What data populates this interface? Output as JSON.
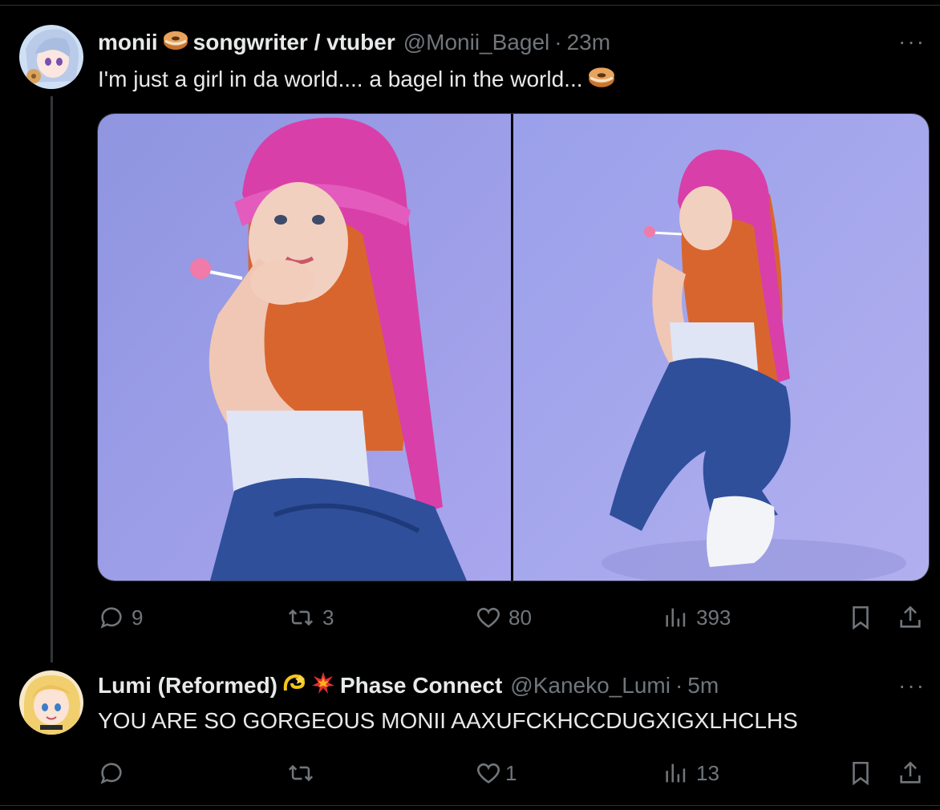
{
  "tweets": [
    {
      "display_name": "monii",
      "bio_tag": "songwriter / vtuber",
      "handle": "@Monii_Bagel",
      "time": "23m",
      "text": "I'm just a girl in da world.... a bagel in the world...",
      "stats": {
        "replies": "9",
        "retweets": "3",
        "likes": "80",
        "views": "393"
      }
    },
    {
      "display_name": "Lumi (Reformed)",
      "org": "Phase Connect",
      "handle": "@Kaneko_Lumi",
      "time": "5m",
      "text": "YOU ARE SO GORGEOUS MONII AAXUFCKHCCDUGXIGXLHCLHS",
      "stats": {
        "replies": "",
        "retweets": "",
        "likes": "1",
        "views": "13"
      }
    }
  ],
  "ui": {
    "dot": "·",
    "more": "···"
  },
  "icons": {
    "reply": "reply-icon",
    "retweet": "retweet-icon",
    "like": "heart-icon",
    "views": "views-icon",
    "bookmark": "bookmark-icon",
    "share": "share-icon",
    "bagel": "bagel-emoji",
    "dizzy": "dizzy-emoji",
    "collision": "collision-emoji"
  },
  "colors": {
    "background": "#000000",
    "text": "#e7e9ea",
    "muted": "#71767b",
    "border": "#2f3336"
  }
}
